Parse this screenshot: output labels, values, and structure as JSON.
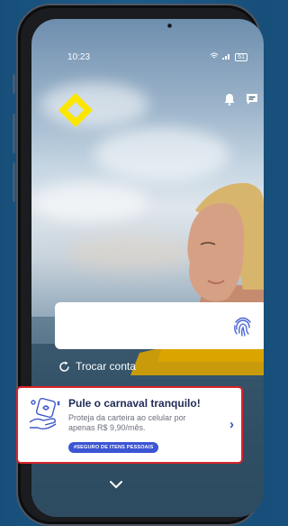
{
  "status_bar": {
    "time": "10:23",
    "battery": "61"
  },
  "login": {
    "switch_account_label": "Trocar conta"
  },
  "promo": {
    "title": "Pule o carnaval tranquilo!",
    "text": "Proteja da carteira ao celular por apenas R$ 9,90/mês.",
    "tag": "#SEGURO DE ITENS PESSOAIS"
  },
  "colors": {
    "brand_yellow": "#fbe600",
    "promo_border": "#d8242b",
    "tag_blue": "#3c55d3",
    "title_navy": "#1f2a55"
  },
  "icons": {
    "logo": "banco-do-brasil-logo",
    "notifications": "bell-icon",
    "messages": "message-icon",
    "fingerprint": "fingerprint-icon",
    "switch_account": "refresh-icon",
    "promo_more": "chevron-right-icon",
    "expand": "chevron-down-icon"
  }
}
